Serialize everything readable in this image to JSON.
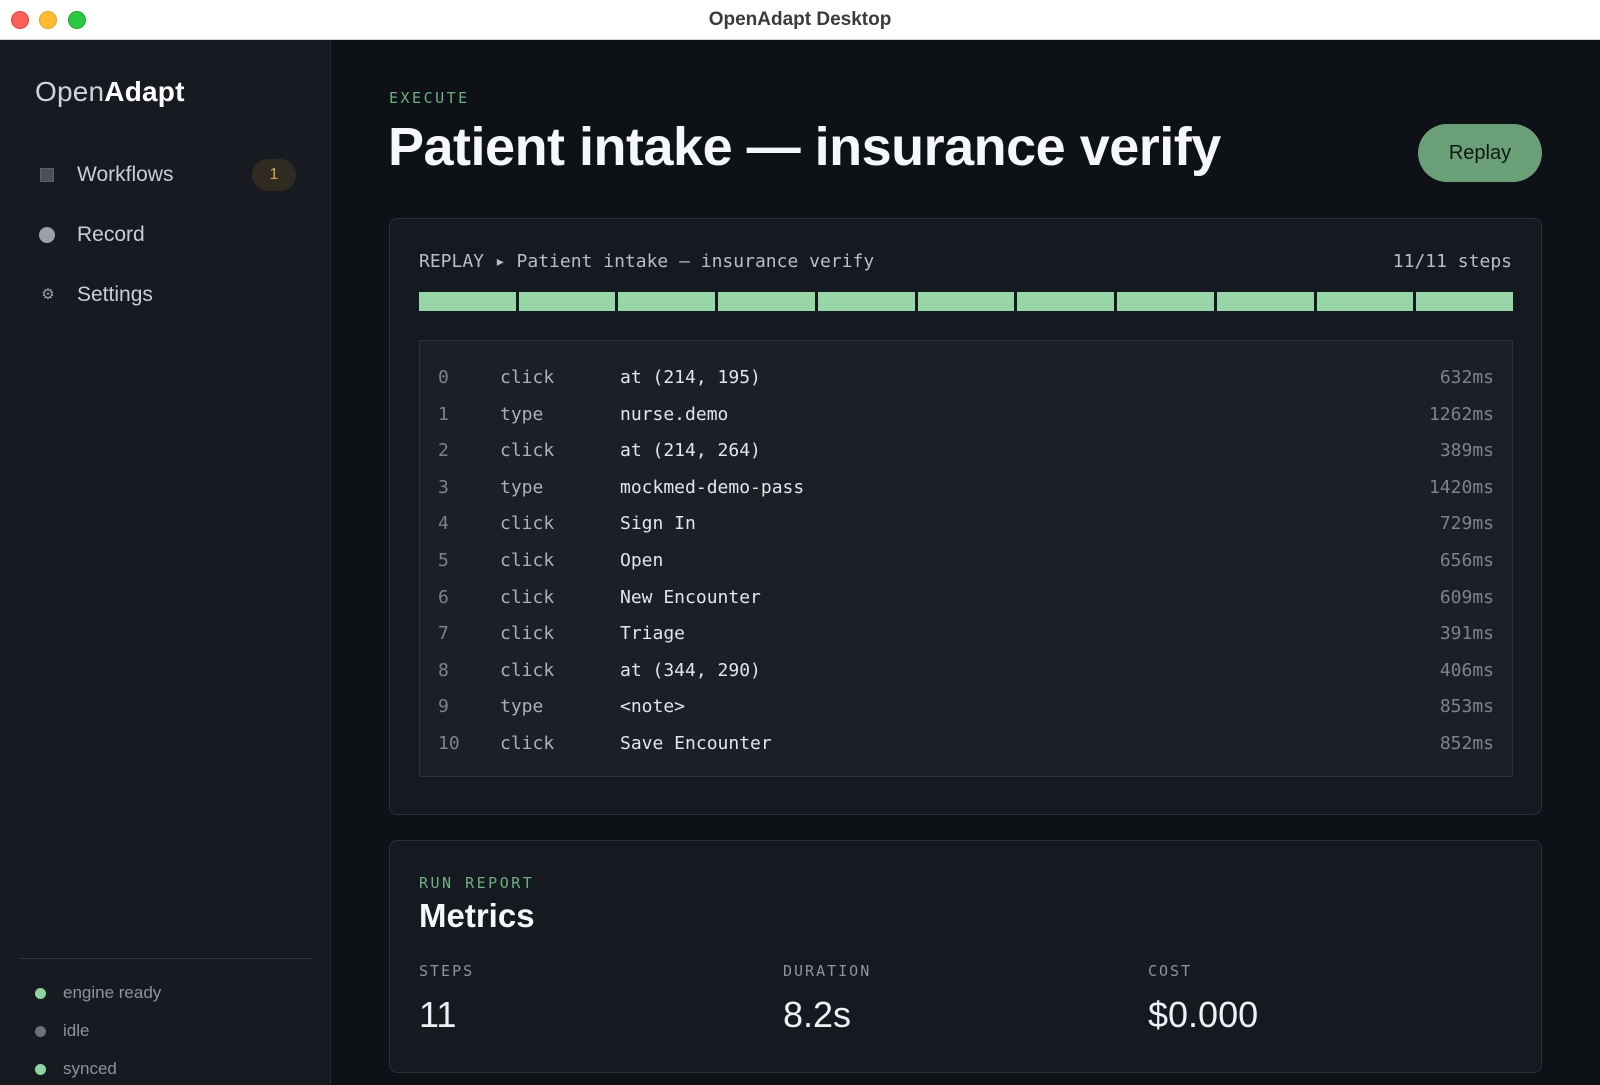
{
  "window": {
    "title": "OpenAdapt Desktop"
  },
  "sidebar": {
    "logo_light": "Open",
    "logo_bold": "Adapt",
    "nav": [
      {
        "label": "Workflows",
        "icon": "workflows-icon",
        "badge": "1"
      },
      {
        "label": "Record",
        "icon": "record-icon"
      },
      {
        "label": "Settings",
        "icon": "gear-icon",
        "glyph": "⚙"
      }
    ],
    "status": [
      {
        "text": "engine ready",
        "color": "#8fd3a1"
      },
      {
        "text": "idle",
        "color": "#6b717a"
      },
      {
        "text": "synced",
        "color": "#8fd3a1"
      }
    ]
  },
  "main": {
    "eyebrow": "EXECUTE",
    "title": "Patient intake — insurance verify",
    "replay_button": "Replay",
    "replay": {
      "header": "REPLAY ▸ Patient intake — insurance verify",
      "count": "11/11 steps",
      "progress": {
        "completed": 11,
        "total": 11,
        "color": "#98d6a7"
      },
      "steps": [
        {
          "idx": "0",
          "action": "click",
          "target": "at (214, 195)",
          "duration": "632ms"
        },
        {
          "idx": "1",
          "action": "type",
          "target": "nurse.demo",
          "duration": "1262ms"
        },
        {
          "idx": "2",
          "action": "click",
          "target": "at (214, 264)",
          "duration": "389ms"
        },
        {
          "idx": "3",
          "action": "type",
          "target": "mockmed-demo-pass",
          "duration": "1420ms"
        },
        {
          "idx": "4",
          "action": "click",
          "target": "Sign In",
          "duration": "729ms"
        },
        {
          "idx": "5",
          "action": "click",
          "target": "Open",
          "duration": "656ms"
        },
        {
          "idx": "6",
          "action": "click",
          "target": "New Encounter",
          "duration": "609ms"
        },
        {
          "idx": "7",
          "action": "click",
          "target": "Triage",
          "duration": "391ms"
        },
        {
          "idx": "8",
          "action": "click",
          "target": "at (344, 290)",
          "duration": "406ms"
        },
        {
          "idx": "9",
          "action": "type",
          "target": "<note>",
          "duration": "853ms"
        },
        {
          "idx": "10",
          "action": "click",
          "target": "Save Encounter",
          "duration": "852ms"
        }
      ]
    },
    "report": {
      "eyebrow": "RUN REPORT",
      "title": "Metrics",
      "metrics": [
        {
          "label": "STEPS",
          "value": "11"
        },
        {
          "label": "DURATION",
          "value": "8.2s"
        },
        {
          "label": "COST",
          "value": "$0.000"
        }
      ]
    }
  }
}
